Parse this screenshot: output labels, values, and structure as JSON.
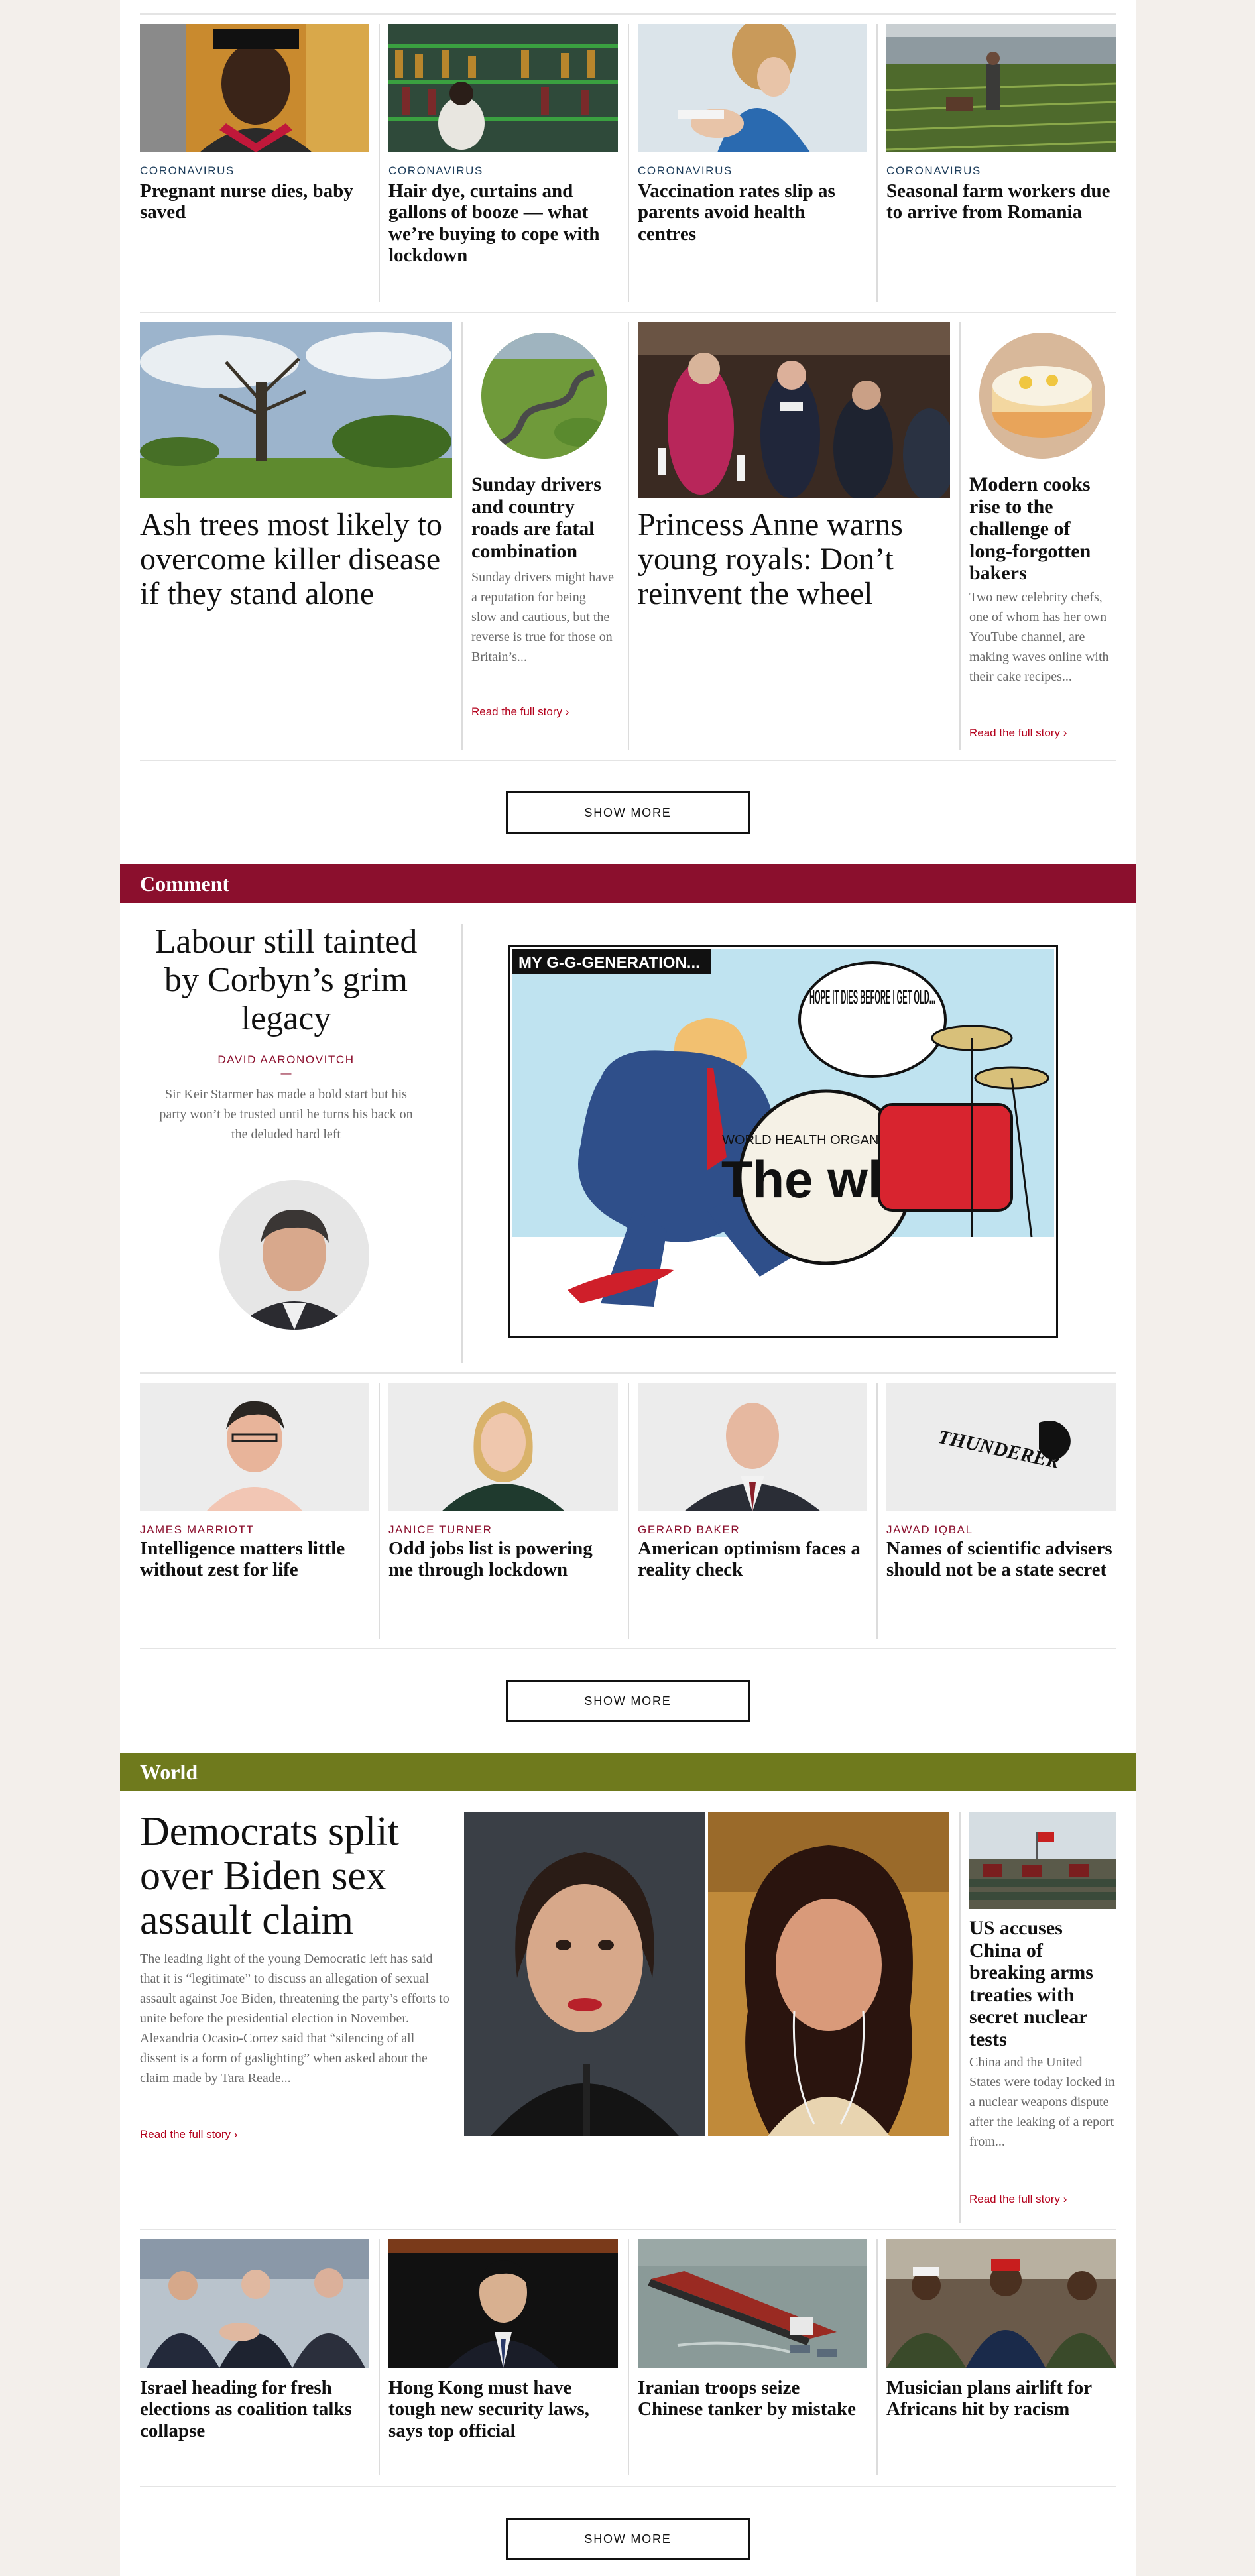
{
  "top_row": [
    {
      "kicker": "CORONAVIRUS",
      "headline": "Pregnant nurse dies, baby saved"
    },
    {
      "kicker": "CORONAVIRUS",
      "headline": "Hair dye, curtains and gallons of booze — what we’re buying to cope with lockdown"
    },
    {
      "kicker": "CORONAVIRUS",
      "headline": "Vaccination rates slip as parents avoid health centres"
    },
    {
      "kicker": "CORONAVIRUS",
      "headline": "Seasonal farm workers due to arrive from Romania"
    }
  ],
  "feature_row": {
    "ash": {
      "headline": "Ash trees most likely to overcome killer disease if they stand alone"
    },
    "drivers": {
      "headline": "Sunday drivers and country roads are fatal combination",
      "blurb": "Sunday drivers might have a reputation for being slow and cautious, but the reverse is true for those on Britain’s...",
      "read_more": "Read the full story ›"
    },
    "anne": {
      "headline": "Princess Anne warns young royals: Don’t reinvent the wheel"
    },
    "cooks": {
      "headline": "Modern cooks rise to the challenge of long-forgotten bakers",
      "blurb": "Two new celebrity chefs, one of whom has her own YouTube channel, are making waves online with their cake recipes...",
      "read_more": "Read the full story ›"
    }
  },
  "show_more_1": "SHOW MORE",
  "comment": {
    "section_title": "Comment",
    "lead": {
      "headline": "Labour still tainted by Corbyn’s grim legacy",
      "author": "DAVID AARONOVITCH",
      "dash": "—",
      "standfirst": "Sir Keir Starmer has made a bold start but his party won’t be trusted until he turns his back on the deluded hard left"
    },
    "cartoon": {
      "caption": "MY G-G-GENERATION...",
      "bubble": "HOPE IT DIES BEFORE I GET OLD...",
      "drum_logo": "The who",
      "drum_ring": "WORLD HEALTH ORGANIZATION"
    },
    "columns": [
      {
        "author": "JAMES MARRIOTT",
        "headline": "Intelligence matters little without zest for life"
      },
      {
        "author": "JANICE TURNER",
        "headline": "Odd jobs list is powering me through lockdown"
      },
      {
        "author": "GERARD BAKER",
        "headline": "American optimism faces a reality check"
      },
      {
        "author": "JAWAD IQBAL",
        "headline": "Names of scientific advisers should not be a state secret",
        "logo": "THUNDERER"
      }
    ],
    "show_more": "SHOW MORE"
  },
  "world": {
    "section_title": "World",
    "lead": {
      "headline": "Democrats split over Biden sex assault claim",
      "blurb": "The leading light of the young Democratic left has said that it is “legitimate” to discuss an allegation of sexual assault against Joe Biden, threatening the party’s efforts to unite before the presidential election in November. Alexandria Ocasio-Cortez said that “silencing of all dissent is a form of gaslighting” when asked about the claim made by Tara Reade...",
      "read_more": "Read the full story ›"
    },
    "side": {
      "headline": "US accuses China of breaking arms treaties with secret nuclear tests",
      "blurb": "China and the United States were today locked in a nuclear weapons dispute after the leaking of a report from...",
      "read_more": "Read the full story ›"
    },
    "row": [
      {
        "headline": "Israel heading for fresh elections as coalition talks collapse"
      },
      {
        "headline": "Hong Kong must have tough new security laws, says top official"
      },
      {
        "headline": "Iranian troops seize Chinese tanker by mistake"
      },
      {
        "headline": "Musician plans airlift for Africans hit by racism"
      }
    ],
    "show_more": "SHOW MORE"
  }
}
